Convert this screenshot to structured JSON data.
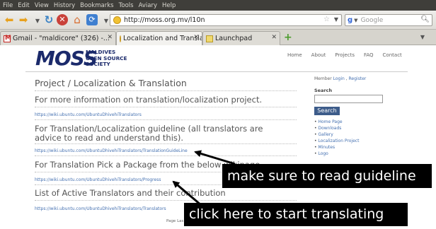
{
  "menubar": {
    "items": [
      "File",
      "Edit",
      "View",
      "History",
      "Bookmarks",
      "Tools",
      "Aviary",
      "Help"
    ]
  },
  "navbar": {
    "url": "http://moss.org.mv/l10n",
    "search_placeholder": "Google",
    "search_engine_letter": "g"
  },
  "tabs": [
    {
      "label": "Gmail - \"maldicore\" (326) -...",
      "icon": "gmail-icon",
      "close": "✕"
    },
    {
      "label": "Localization and Translatio...",
      "icon": "moss-favicon",
      "close": "✕",
      "active": true
    },
    {
      "label": "Launchpad",
      "icon": "launchpad-icon",
      "close": "✕"
    }
  ],
  "new_tab": "+",
  "logo": {
    "word": "MOSS",
    "line1": "MALDIVES",
    "line2": "OPEN SOURCE",
    "line3": "SOCIETY"
  },
  "topnav": [
    "Home",
    "About",
    "Projects",
    "FAQ",
    "Contact"
  ],
  "content": {
    "title": "Project / Localization & Translation",
    "info_heading": "For more information on translation/localization project.",
    "link1": "https://wiki.ubuntu.com/UbuntuDhivehiTranslators",
    "guideline_heading": "For Translation/Localization guideline (all translators are advice to read and understand this).",
    "link2": "https://wiki.ubuntu.com/UbuntuDhivehiTranslators/TranslationGuideLine",
    "pick_heading": "For Translation Pick a Package from the below wikipage.",
    "link3": "https://wiki.ubuntu.com/UbuntuDhivehiTranslators/Progress",
    "list_heading": "List of Active Translators and their contribution",
    "link4": "https://wiki.ubuntu.com/UbuntuDhivehiTranslators/Translators",
    "footer": "Page Las"
  },
  "sidebar": {
    "member_prefix": "Member",
    "login": "Login",
    "register": "Register",
    "search_label": "Search",
    "search_button": "Search",
    "links": [
      "Home Page",
      "Downloads",
      "Gallery",
      "Localization Project",
      "Minutes",
      "Logo"
    ]
  },
  "annotations": {
    "guideline_note": "make sure to read guideline",
    "translate_note": "click here to start translating"
  }
}
